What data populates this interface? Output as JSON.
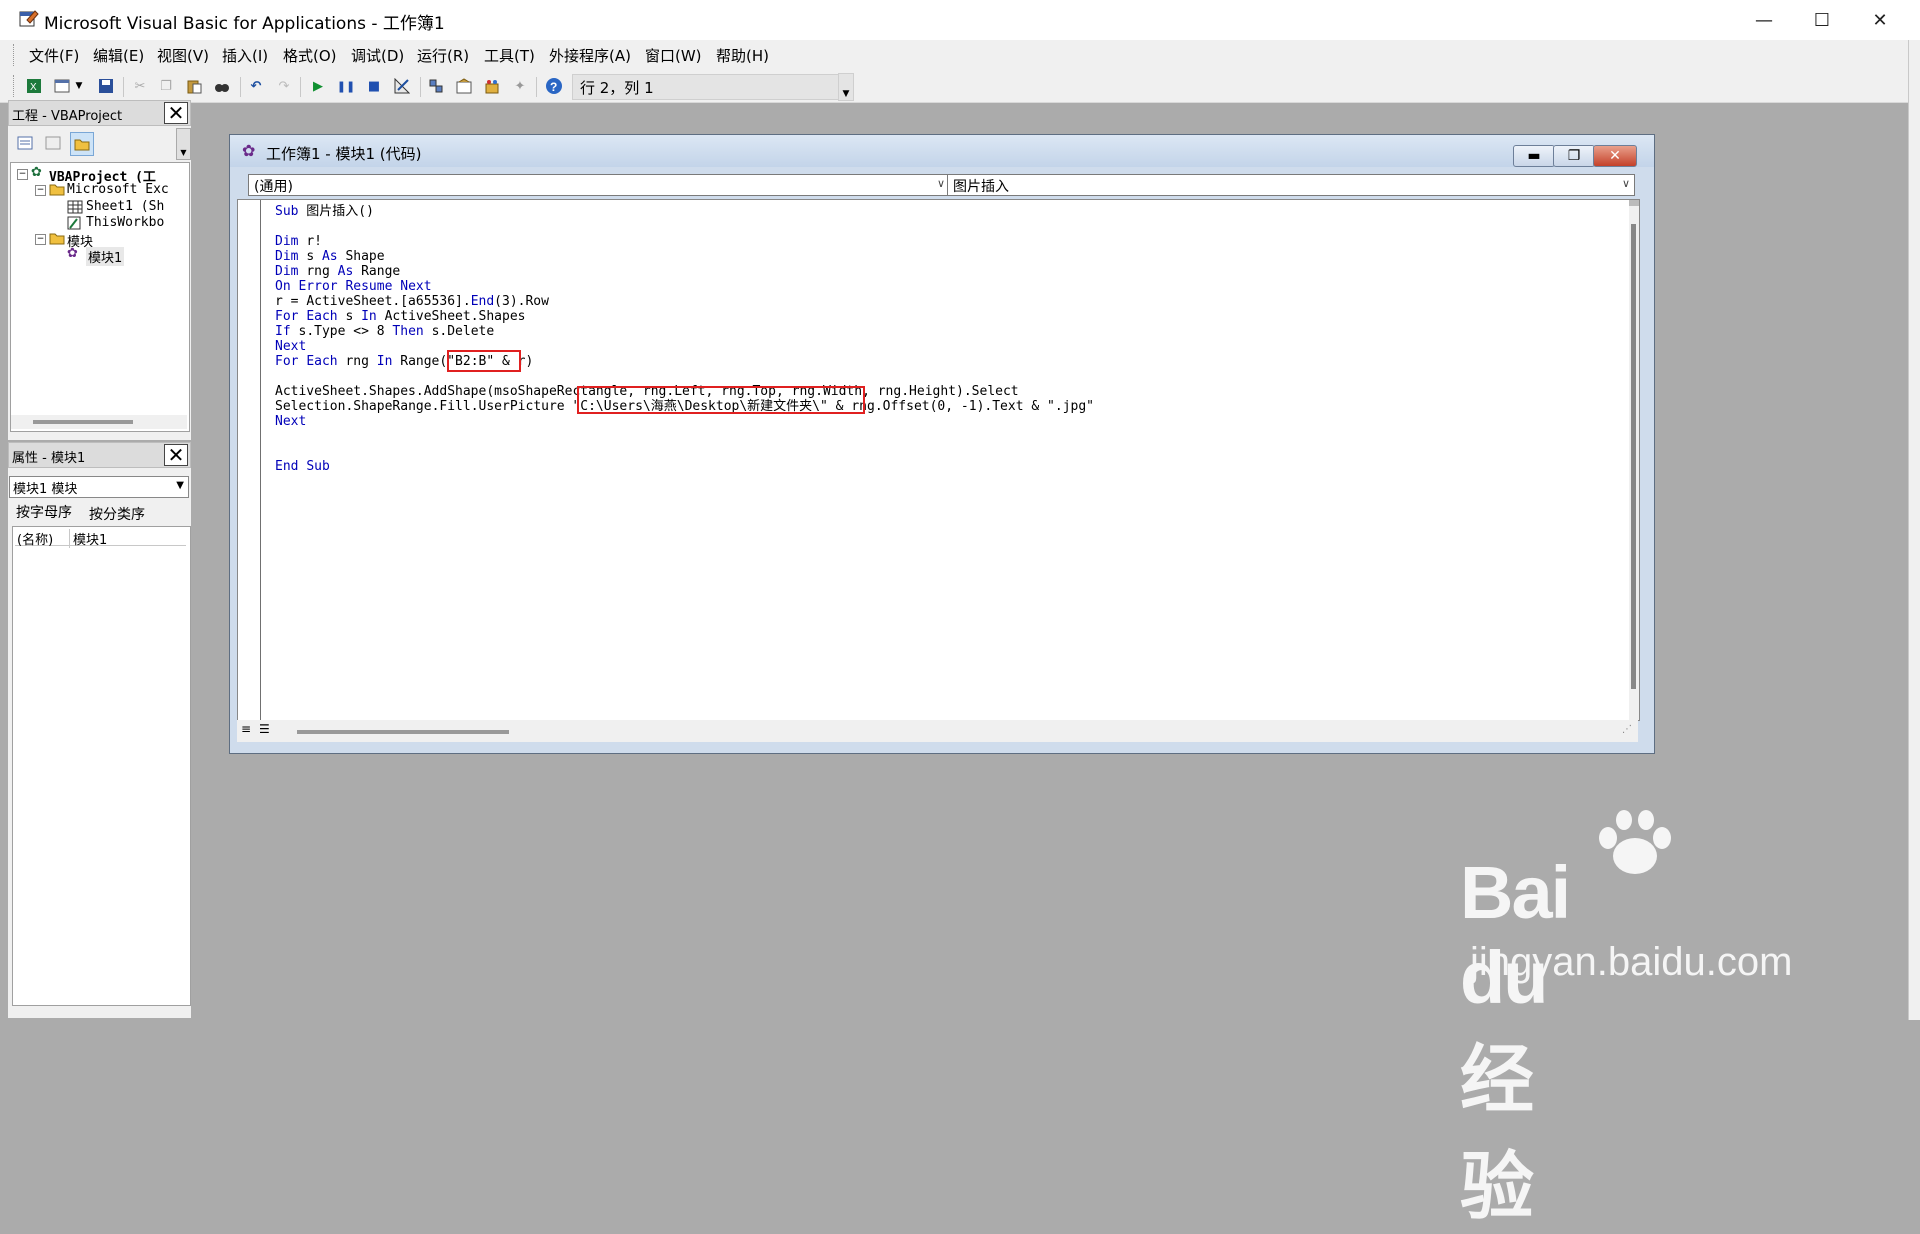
{
  "window": {
    "title": "Microsoft Visual Basic for Applications - 工作簿1",
    "minimize": "—",
    "maximize": "☐",
    "close": "✕"
  },
  "menu": [
    "文件(F)",
    "编辑(E)",
    "视图(V)",
    "插入(I)",
    "格式(O)",
    "调试(D)",
    "运行(R)",
    "工具(T)",
    "外接程序(A)",
    "窗口(W)",
    "帮助(H)"
  ],
  "toolbar": {
    "icons": [
      "excel-icon",
      "insert-userform-icon",
      "dropdown-arrow-icon",
      "save-icon",
      "cut-icon",
      "copy-icon",
      "paste-icon",
      "find-icon",
      "undo-icon",
      "redo-icon",
      "run-icon",
      "break-icon",
      "reset-icon",
      "design-mode-icon",
      "project-explorer-icon",
      "properties-icon",
      "object-browser-icon",
      "toolbox-icon",
      "help-icon"
    ],
    "position": "行 2，列 1"
  },
  "project_panel": {
    "title": "工程 - VBAProject",
    "tree": [
      {
        "label": "VBAProject (工",
        "level": 0,
        "expander": "−"
      },
      {
        "label": "Microsoft Exc",
        "level": 1,
        "expander": "−"
      },
      {
        "label": "Sheet1 (Sh",
        "level": 2
      },
      {
        "label": "ThisWorkbo",
        "level": 2
      },
      {
        "label": "模块",
        "level": 1,
        "expander": "−"
      },
      {
        "label": "模块1",
        "level": 2
      }
    ]
  },
  "properties_panel": {
    "title": "属性 - 模块1",
    "object": "模块1 模块",
    "tabs": [
      "按字母序",
      "按分类序"
    ],
    "rows": [
      {
        "name": "(名称)",
        "value": "模块1"
      }
    ]
  },
  "code_window": {
    "title": "工作簿1 - 模块1 (代码)",
    "object_combo": "(通用)",
    "proc_combo": "图片插入",
    "lines": [
      "Sub 图片插入()",
      "",
      "Dim r!",
      "Dim s As Shape",
      "Dim rng As Range",
      "On Error Resume Next",
      "r = ActiveSheet.[a65536].End(3).Row",
      "For Each s In ActiveSheet.Shapes",
      "If s.Type <> 8 Then s.Delete",
      "Next",
      "For Each rng In Range(\"B2:B\" & r)",
      "",
      "ActiveSheet.Shapes.AddShape(msoShapeRectangle, rng.Left, rng.Top, rng.Width, rng.Height).Select",
      "Selection.ShapeRange.Fill.UserPicture \"C:\\Users\\海燕\\Desktop\\新建文件夹\\\" & rng.Offset(0, -1).Text & \".jpg\"",
      "Next",
      "",
      "",
      "End Sub"
    ],
    "keywords": [
      "Sub",
      "Dim",
      "As",
      "On",
      "Error",
      "Resume",
      "Next",
      "For",
      "Each",
      "In",
      "If",
      "Then",
      "End"
    ]
  },
  "watermark": {
    "main": "Bai du 经验",
    "sub": "jingyan.baidu.com"
  }
}
